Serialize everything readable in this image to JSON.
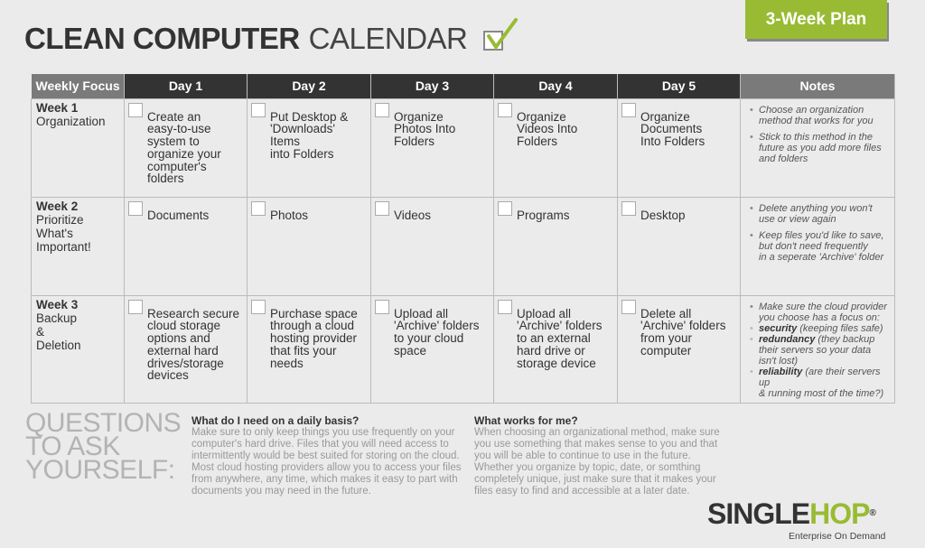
{
  "title": {
    "bold": "CLEAN COMPUTER",
    "light": "CALENDAR"
  },
  "badge": "3-Week Plan",
  "colors": {
    "accent": "#99bb33",
    "header_dark": "#333333",
    "header_gray": "#7a7a7a"
  },
  "table": {
    "headers": [
      "Weekly Focus",
      "Day 1",
      "Day 2",
      "Day 3",
      "Day 4",
      "Day 5",
      "Notes"
    ],
    "rows": [
      {
        "week": "Week 1",
        "focus": "Organization",
        "tasks": [
          "Create an\neasy-to-use\nsystem to\norganize your\ncomputer's\nfolders",
          "Put Desktop &\n'Downloads'\nItems\ninto Folders",
          "Organize\nPhotos Into\nFolders",
          "Organize\nVideos Into\nFolders",
          "Organize\nDocuments\nInto Folders"
        ],
        "notes": [
          "Choose an organization\nmethod that works for you",
          "Stick to this method in the\nfuture as you add more files\nand folders"
        ]
      },
      {
        "week": "Week 2",
        "focus": "Prioritize\nWhat's\nImportant!",
        "tasks": [
          "Documents",
          "Photos",
          "Videos",
          "Programs",
          "Desktop"
        ],
        "notes": [
          "Delete anything you won't\nuse or view again",
          "Keep files you'd like to save,\nbut don't need frequently\nin a seperate 'Archive' folder"
        ]
      },
      {
        "week": "Week 3",
        "focus": "Backup\n&\nDeletion",
        "tasks": [
          "Research secure\ncloud storage\noptions and\nexternal hard\ndrives/storage\ndevices",
          "Purchase space\nthrough a cloud\nhosting provider\nthat fits your\nneeds",
          "Upload all\n'Archive' folders\nto your cloud\nspace",
          "Upload all\n'Archive' folders\nto an external\nhard drive or\nstorage device",
          "Delete all\n'Archive' folders\nfrom your\ncomputer"
        ],
        "notes": [
          "Make sure the cloud provider\nyou choose has a focus on:",
          {
            "bold": "security",
            "text": " (keeping files safe)"
          },
          {
            "bold": "redundancy",
            "text": " (they backup\ntheir servers so your data\nisn't lost)"
          },
          {
            "bold": "reliability",
            "text": " (are their servers up\n& running most of the time?)"
          }
        ]
      }
    ]
  },
  "questions": {
    "heading": "QUESTIONS\nTO ASK\nYOURSELF:",
    "q1": {
      "title": "What do I need on a daily basis?",
      "body": "Make sure to only keep things you use frequently on your computer's hard drive. Files that you will need access to intermittently would be best suited for storing on the cloud. Most cloud hosting providers allow you to access your files from anywhere, any time, which makes it easy to part with documents you may need in the future."
    },
    "q2": {
      "title": "What works for me?",
      "body": "When choosing an organizational method, make sure you use something that makes sense to you and that you will be able to continue to use in the future. Whether you organize by topic, date, or somthing completely unique, just make sure that it makes your files easy to find and accessible at a later date."
    }
  },
  "logo": {
    "part1": "SINGLE",
    "part2": "HOP",
    "reg": "®",
    "tagline": "Enterprise On Demand"
  }
}
